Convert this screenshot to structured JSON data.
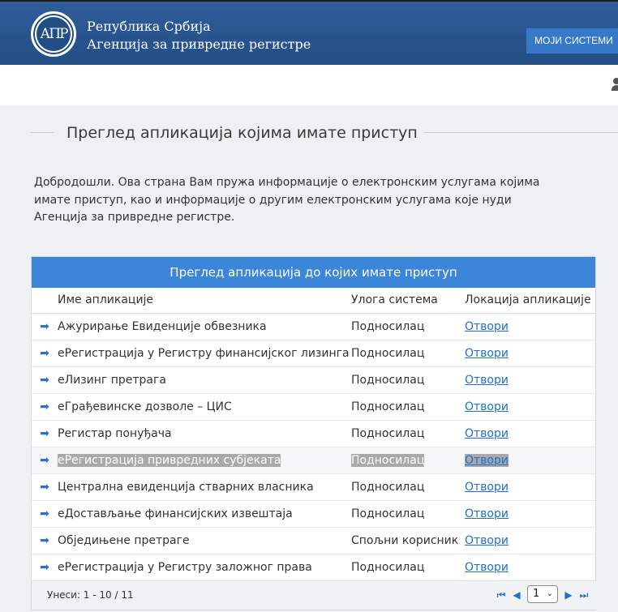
{
  "header": {
    "logo_text": "АПР",
    "brand_line1": "Република Србија",
    "brand_line2": "Агенција за привредне регистре",
    "systems_button": "МОЈИ СИСТЕМИ"
  },
  "page": {
    "title": "Преглед апликација којима имате приступ",
    "intro": "Добродошли. Ова страна Вам пружа информације о електронским услугама којима имате приступ, као и информације о другим електронским услугама које нуди Агенција за привредне регистре."
  },
  "panel": {
    "title": "Преглед апликација до којих имате приступ",
    "columns": [
      "Име апликације",
      "Улога система",
      "Локација апликације"
    ],
    "rows": [
      {
        "name": "Ажурирање Евиденције обвезника",
        "role": "Подносилац",
        "link": "Отвори"
      },
      {
        "name": "еРегистрација у Регистру финансијског лизинга",
        "role": "Подносилац",
        "link": "Отвори"
      },
      {
        "name": "еЛизинг претрага",
        "role": "Подносилац",
        "link": "Отвори"
      },
      {
        "name": "еГрађевинске дозволе – ЦИС",
        "role": "Подносилац",
        "link": "Отвори"
      },
      {
        "name": "Регистар понуђача",
        "role": "Подносилац",
        "link": "Отвори"
      },
      {
        "name": "еРегистрација привредних субјеката",
        "role": "Подносилац",
        "link": "Отвори"
      },
      {
        "name": "Централна евиденција стварних власника",
        "role": "Подносилац",
        "link": "Отвори"
      },
      {
        "name": "еДостављање финансијских извештаја",
        "role": "Подносилац",
        "link": "Отвори"
      },
      {
        "name": "Обједињене претраге",
        "role": "Спољни корисник",
        "link": "Отвори"
      },
      {
        "name": "еРегистрација у Регистру заложног права",
        "role": "Подносилац",
        "link": "Отвори"
      }
    ],
    "pager": {
      "count": "Унеси: 1 - 10 / 11",
      "page": "1"
    }
  },
  "icons": {
    "row_icon": "arrow-right-icon",
    "pager": [
      "first-page-icon",
      "prev-page-icon",
      "next-page-icon",
      "last-page-icon"
    ],
    "user": "user-icon"
  },
  "colors": {
    "header_bg": "#2f5d9a",
    "accent_button": "#3679c8",
    "panel_header": "#3b86d8",
    "link": "#1f6fd1",
    "highlight": "#a9a9a9"
  }
}
